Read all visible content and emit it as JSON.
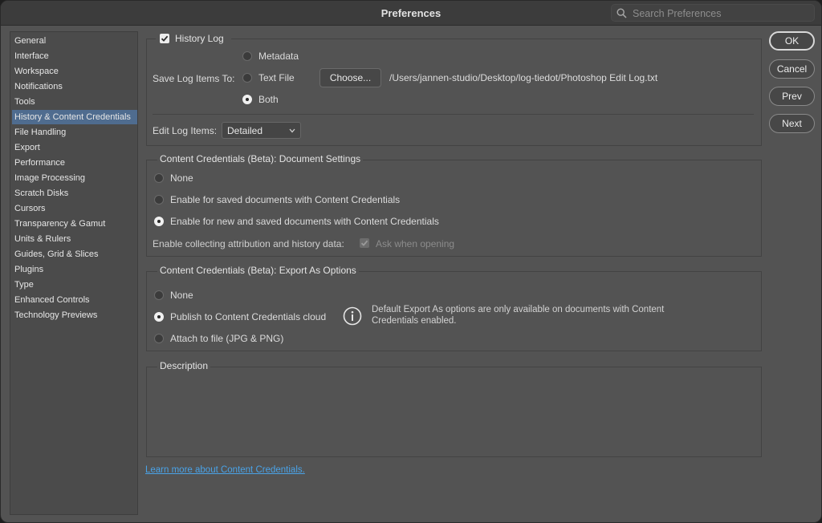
{
  "window": {
    "title": "Preferences",
    "search_placeholder": "Search Preferences"
  },
  "sidebar": {
    "items": [
      {
        "label": "General"
      },
      {
        "label": "Interface"
      },
      {
        "label": "Workspace"
      },
      {
        "label": "Notifications"
      },
      {
        "label": "Tools"
      },
      {
        "label": "History & Content Credentials",
        "selected": true
      },
      {
        "label": "File Handling"
      },
      {
        "label": "Export"
      },
      {
        "label": "Performance"
      },
      {
        "label": "Image Processing"
      },
      {
        "label": "Scratch Disks"
      },
      {
        "label": "Cursors"
      },
      {
        "label": "Transparency & Gamut"
      },
      {
        "label": "Units & Rulers"
      },
      {
        "label": "Guides, Grid & Slices"
      },
      {
        "label": "Plugins"
      },
      {
        "label": "Type"
      },
      {
        "label": "Enhanced Controls"
      },
      {
        "label": "Technology Previews"
      }
    ]
  },
  "history": {
    "title": "History Log",
    "enabled": true,
    "save_label": "Save Log Items To:",
    "options": {
      "metadata": "Metadata",
      "text_file": "Text File",
      "both": "Both"
    },
    "selected": "both",
    "choose_label": "Choose...",
    "path": "/Users/jannen-studio/Desktop/log-tiedot/Photoshop Edit Log.txt",
    "edit_label": "Edit Log Items:",
    "edit_value": "Detailed"
  },
  "doc_settings": {
    "title": "Content Credentials (Beta): Document Settings",
    "options": {
      "none": "None",
      "saved": "Enable for saved documents with Content Credentials",
      "new_saved": "Enable for new and saved documents with Content Credentials"
    },
    "selected": "new_saved",
    "collect_label": "Enable collecting attribution and history data:",
    "ask_label": "Ask when opening",
    "ask_checked": true
  },
  "export_options": {
    "title": "Content Credentials (Beta): Export As Options",
    "options": {
      "none": "None",
      "publish": "Publish to Content Credentials cloud",
      "attach": "Attach to file (JPG & PNG)"
    },
    "selected": "publish",
    "info_icon": "info-circle-icon",
    "info_line1": "Default Export As options are only available on documents with Content",
    "info_line2": "Credentials enabled."
  },
  "description": {
    "title": "Description"
  },
  "learn_more": "Learn more about Content Credentials.",
  "buttons": {
    "ok": "OK",
    "cancel": "Cancel",
    "prev": "Prev",
    "next": "Next"
  },
  "colors": {
    "accent_selection": "#4f6c8f",
    "link": "#4aa3e8",
    "window_bg": "#535353"
  }
}
